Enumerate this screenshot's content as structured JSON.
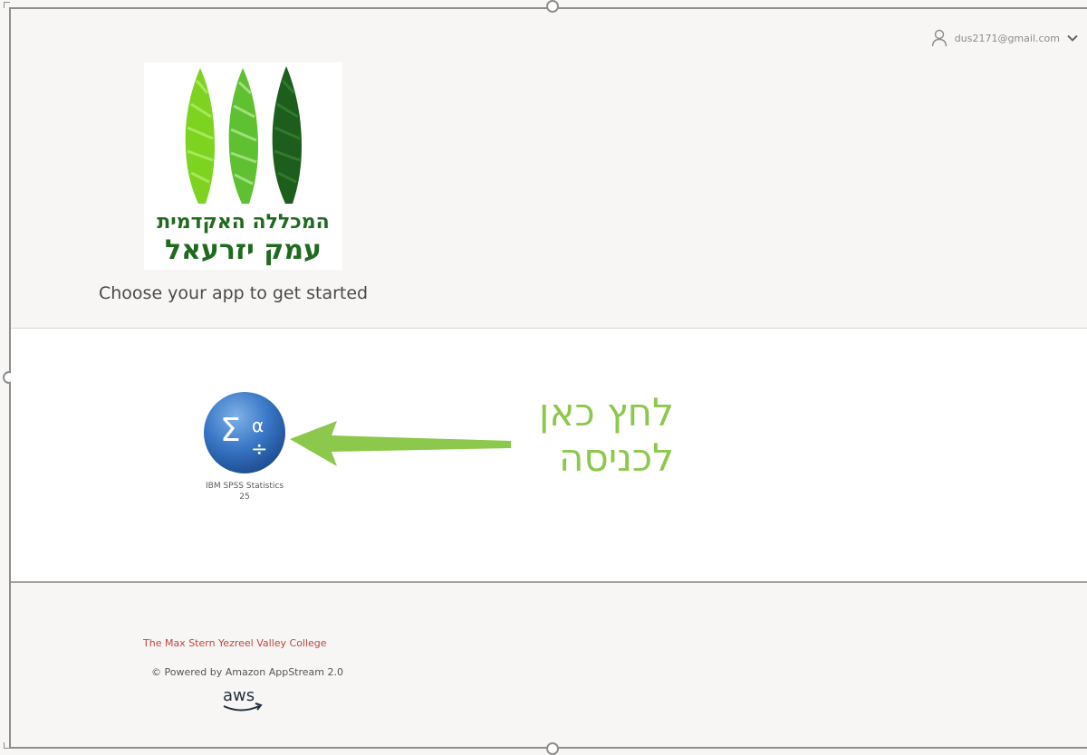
{
  "user_menu": {
    "email": "dus2171@gmail.com",
    "user_icon": "user-icon",
    "chevron_icon": "chevron-down-icon"
  },
  "logo": {
    "line1": "המכללה האקדמית",
    "line2": "עמק יזרעאל",
    "colors": {
      "light": "#7ed321",
      "medium": "#3fa52c",
      "dark": "#1d5e1d"
    }
  },
  "tagline": "Choose your app to get started",
  "apps": [
    {
      "label_line1": "IBM SPSS Statistics",
      "label_line2": "25",
      "icon": "spss-sigma-alpha-icon"
    }
  ],
  "annotation": {
    "line1": "לחץ כאן",
    "line2": "לכניסה",
    "color": "#8cc84b"
  },
  "footer": {
    "college": "The Max Stern Yezreel Valley College",
    "powered": "© Powered by Amazon AppStream 2.0",
    "aws_logo_text": "aws"
  }
}
